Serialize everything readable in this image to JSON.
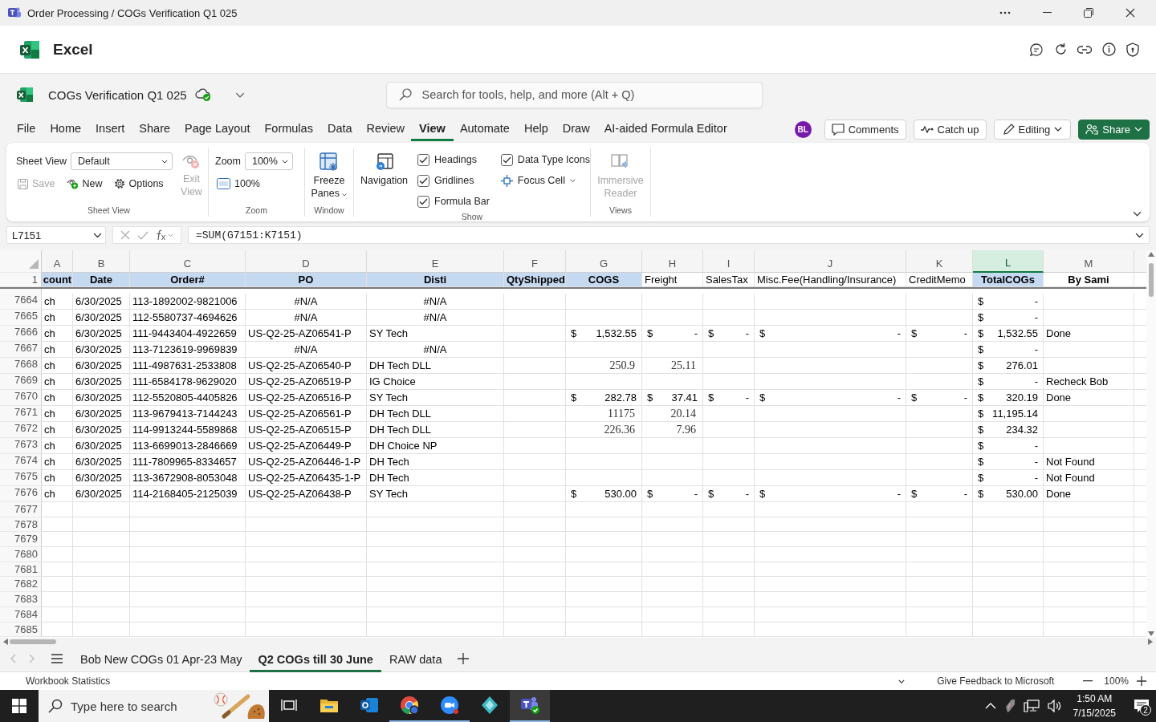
{
  "title_bar": {
    "title": "Order Processing / COGs Verification Q1 025"
  },
  "app": {
    "name": "Excel"
  },
  "document": {
    "name": "COGs Verification Q1 025"
  },
  "search": {
    "placeholder": "Search for tools, help, and more (Alt + Q)"
  },
  "menu_tabs": [
    {
      "label": "File",
      "selected": false
    },
    {
      "label": "Home",
      "selected": false
    },
    {
      "label": "Insert",
      "selected": false
    },
    {
      "label": "Share",
      "selected": false
    },
    {
      "label": "Page Layout",
      "selected": false
    },
    {
      "label": "Formulas",
      "selected": false
    },
    {
      "label": "Data",
      "selected": false
    },
    {
      "label": "Review",
      "selected": false
    },
    {
      "label": "View",
      "selected": true
    },
    {
      "label": "Automate",
      "selected": false
    },
    {
      "label": "Help",
      "selected": false
    },
    {
      "label": "Draw",
      "selected": false
    },
    {
      "label": "AI-aided Formula Editor",
      "selected": false
    }
  ],
  "user": {
    "initials": "BL"
  },
  "actions": [
    {
      "label": "Comments",
      "kind": "comments"
    },
    {
      "label": "Catch up",
      "kind": "catchup"
    },
    {
      "label": "Editing",
      "kind": "editing"
    },
    {
      "label": "Share",
      "kind": "share"
    }
  ],
  "ribbon": {
    "sheet_view": {
      "label": "Sheet View",
      "select_label": "Sheet View",
      "select_value": "Default",
      "save": {
        "label": "Save",
        "disabled": true
      },
      "new": {
        "label": "New",
        "disabled": false
      },
      "options": {
        "label": "Options",
        "disabled": false
      },
      "exit_view": {
        "label": "Exit View",
        "disabled": true
      }
    },
    "zoom": {
      "label": "Zoom",
      "select_label": "Zoom",
      "select_value": "100%",
      "button": "100%"
    },
    "window": {
      "label": "Window",
      "freeze_panes": "Freeze Panes"
    },
    "show": {
      "label": "Show",
      "navigation": "Navigation",
      "checkboxes": [
        {
          "label": "Headings",
          "checked": true
        },
        {
          "label": "Gridlines",
          "checked": true
        },
        {
          "label": "Formula Bar",
          "checked": true
        },
        {
          "label": "Data Type Icons",
          "checked": true
        }
      ],
      "focus_cell": "Focus Cell"
    },
    "views": {
      "label": "Views",
      "immersive_reader": {
        "label": "Immersive Reader",
        "disabled": true
      }
    }
  },
  "formula_bar": {
    "name_box": "L7151",
    "formula": "=SUM(G7151:K7151)"
  },
  "grid": {
    "columns": [
      {
        "letter": "A",
        "selected": false
      },
      {
        "letter": "B",
        "selected": false
      },
      {
        "letter": "C",
        "selected": false
      },
      {
        "letter": "D",
        "selected": false
      },
      {
        "letter": "E",
        "selected": false
      },
      {
        "letter": "F",
        "selected": false
      },
      {
        "letter": "G",
        "selected": false
      },
      {
        "letter": "H",
        "selected": false
      },
      {
        "letter": "I",
        "selected": false
      },
      {
        "letter": "J",
        "selected": false
      },
      {
        "letter": "K",
        "selected": false
      },
      {
        "letter": "L",
        "selected": true
      },
      {
        "letter": "M",
        "selected": false
      }
    ],
    "header_row": {
      "number": "1",
      "cells": [
        {
          "value": "count",
          "bold": true,
          "highlighted": true
        },
        {
          "value": "Date",
          "bold": true,
          "highlighted": true
        },
        {
          "value": "Order#",
          "bold": true,
          "highlighted": true
        },
        {
          "value": "PO",
          "bold": true,
          "highlighted": true
        },
        {
          "value": "Disti",
          "bold": true,
          "highlighted": true
        },
        {
          "value": "QtyShipped",
          "bold": true,
          "highlighted": true
        },
        {
          "value": "COGS",
          "bold": true,
          "highlighted": true
        },
        {
          "value": "Freight",
          "bold": false,
          "highlighted": false
        },
        {
          "value": "SalesTax",
          "bold": false,
          "highlighted": false
        },
        {
          "value": "Misc.Fee(Handling/Insurance)",
          "bold": false,
          "highlighted": false
        },
        {
          "value": "CreditMemo",
          "bold": false,
          "highlighted": false
        },
        {
          "value": "TotalCOGs",
          "bold": true,
          "highlighted": true
        },
        {
          "value": "By Sami",
          "bold": true,
          "highlighted": false
        }
      ]
    },
    "rows": [
      {
        "number": "7664",
        "cells": [
          "ch",
          "6/30/2025",
          "113-1892002-9821006",
          {
            "kind": "center",
            "value": "#N/A"
          },
          {
            "kind": "center",
            "value": "#N/A"
          },
          null,
          null,
          null,
          null,
          null,
          null,
          {
            "kind": "accounting",
            "value": "$ -"
          },
          null
        ]
      },
      {
        "number": "7665",
        "cells": [
          "ch",
          "6/30/2025",
          "112-5580737-4694626",
          {
            "kind": "center",
            "value": "#N/A"
          },
          {
            "kind": "center",
            "value": "#N/A"
          },
          null,
          null,
          null,
          null,
          null,
          null,
          {
            "kind": "accounting",
            "value": "$ -"
          },
          null
        ]
      },
      {
        "number": "7666",
        "cells": [
          "ch",
          "6/30/2025",
          "111-9443404-4922659",
          "US-Q2-25-AZ06541-P",
          "SY Tech",
          null,
          {
            "kind": "accounting",
            "value": "$ 1,532.55"
          },
          {
            "kind": "accounting",
            "value": "$ -"
          },
          {
            "kind": "accounting",
            "value": "$ -"
          },
          {
            "kind": "accounting",
            "value": "$ -"
          },
          {
            "kind": "accounting",
            "value": "$ -"
          },
          {
            "kind": "accounting",
            "value": "$ 1,532.55"
          },
          "Done"
        ]
      },
      {
        "number": "7667",
        "cells": [
          "ch",
          "6/30/2025",
          "113-7123619-9969839",
          {
            "kind": "center",
            "value": "#N/A"
          },
          {
            "kind": "center",
            "value": "#N/A"
          },
          null,
          null,
          null,
          null,
          null,
          null,
          {
            "kind": "accounting",
            "value": "$ -"
          },
          null
        ]
      },
      {
        "number": "7668",
        "cells": [
          "ch",
          "6/30/2025",
          "111-4987631-2533808",
          "US-Q2-25-AZ06540-P",
          "DH Tech DLL",
          null,
          {
            "kind": "number",
            "value": "250.9"
          },
          {
            "kind": "number",
            "value": "25.11"
          },
          null,
          null,
          null,
          {
            "kind": "accounting",
            "value": "$ 276.01"
          },
          null
        ]
      },
      {
        "number": "7669",
        "cells": [
          "ch",
          "6/30/2025",
          "111-6584178-9629020",
          "US-Q2-25-AZ06519-P",
          "IG Choice",
          null,
          null,
          null,
          null,
          null,
          null,
          {
            "kind": "accounting",
            "value": "$ -"
          },
          "Recheck Bob"
        ]
      },
      {
        "number": "7670",
        "cells": [
          "ch",
          "6/30/2025",
          "112-5520805-4405826",
          "US-Q2-25-AZ06516-P",
          "SY Tech",
          null,
          {
            "kind": "accounting",
            "value": "$ 282.78"
          },
          {
            "kind": "accounting",
            "value": "$ 37.41"
          },
          {
            "kind": "accounting",
            "value": "$ -"
          },
          {
            "kind": "accounting",
            "value": "$ -"
          },
          {
            "kind": "accounting",
            "value": "$ -"
          },
          {
            "kind": "accounting",
            "value": "$ 320.19"
          },
          "Done"
        ]
      },
      {
        "number": "7671",
        "cells": [
          "ch",
          "6/30/2025",
          "113-9679413-7144243",
          "US-Q2-25-AZ06561-P",
          "DH Tech DLL",
          null,
          {
            "kind": "number",
            "value": "11175"
          },
          {
            "kind": "number",
            "value": "20.14"
          },
          null,
          null,
          null,
          {
            "kind": "accounting",
            "value": "$ 11,195.14"
          },
          null
        ]
      },
      {
        "number": "7672",
        "cells": [
          "ch",
          "6/30/2025",
          "114-9913244-5589868",
          "US-Q2-25-AZ06515-P",
          "DH Tech DLL",
          null,
          {
            "kind": "number",
            "value": "226.36"
          },
          {
            "kind": "number",
            "value": "7.96"
          },
          null,
          null,
          null,
          {
            "kind": "accounting",
            "value": "$ 234.32"
          },
          null
        ]
      },
      {
        "number": "7673",
        "cells": [
          "ch",
          "6/30/2025",
          "113-6699013-2846669",
          "US-Q2-25-AZ06449-P",
          "DH Choice NP",
          null,
          null,
          null,
          null,
          null,
          null,
          {
            "kind": "accounting",
            "value": "$ -"
          },
          null
        ]
      },
      {
        "number": "7674",
        "cells": [
          "ch",
          "6/30/2025",
          "111-7809965-8334657",
          "US-Q2-25-AZ06446-1-P",
          "DH Tech",
          null,
          null,
          null,
          null,
          null,
          null,
          {
            "kind": "accounting",
            "value": "$ -"
          },
          "Not Found"
        ]
      },
      {
        "number": "7675",
        "cells": [
          "ch",
          "6/30/2025",
          "113-3672908-8053048",
          "US-Q2-25-AZ06435-1-P",
          "DH Tech",
          null,
          null,
          null,
          null,
          null,
          null,
          {
            "kind": "accounting",
            "value": "$ -"
          },
          "Not Found"
        ]
      },
      {
        "number": "7676",
        "cells": [
          "ch",
          "6/30/2025",
          "114-2168405-2125039",
          "US-Q2-25-AZ06438-P",
          "SY Tech",
          null,
          {
            "kind": "accounting",
            "value": "$ 530.00"
          },
          {
            "kind": "accounting",
            "value": "$ -"
          },
          {
            "kind": "accounting",
            "value": "$ -"
          },
          {
            "kind": "accounting",
            "value": "$ -"
          },
          {
            "kind": "accounting",
            "value": "$ -"
          },
          {
            "kind": "accounting",
            "value": "$ 530.00"
          },
          "Done"
        ]
      },
      {
        "number": "7677"
      },
      {
        "number": "7678"
      },
      {
        "number": "7679"
      },
      {
        "number": "7680"
      },
      {
        "number": "7681"
      },
      {
        "number": "7682"
      },
      {
        "number": "7683"
      },
      {
        "number": "7684"
      },
      {
        "number": "7685"
      }
    ]
  },
  "sheet_tabs": [
    {
      "label": "Bob New COGs 01 Apr-23 May",
      "selected": false
    },
    {
      "label": "Q2 COGs till 30 June",
      "selected": true
    },
    {
      "label": "RAW data",
      "selected": false
    }
  ],
  "status_bar": {
    "left": "Workbook Statistics",
    "feedback": "Give Feedback to Microsoft",
    "zoom": "100%"
  },
  "taskbar": {
    "search_placeholder": "Type here to search",
    "apps": [
      {
        "kind": "task-view",
        "running": false,
        "selected": false
      },
      {
        "kind": "explorer",
        "running": false,
        "selected": false
      },
      {
        "kind": "outlook",
        "running": false,
        "selected": false
      },
      {
        "kind": "chrome",
        "running": true,
        "selected": false
      },
      {
        "kind": "zoom",
        "running": true,
        "selected": false
      },
      {
        "kind": "cube",
        "running": false,
        "selected": false
      },
      {
        "kind": "teams",
        "running": true,
        "selected": true
      }
    ],
    "time": "1:50 AM",
    "date": "7/15/2025",
    "notifications": "2"
  }
}
